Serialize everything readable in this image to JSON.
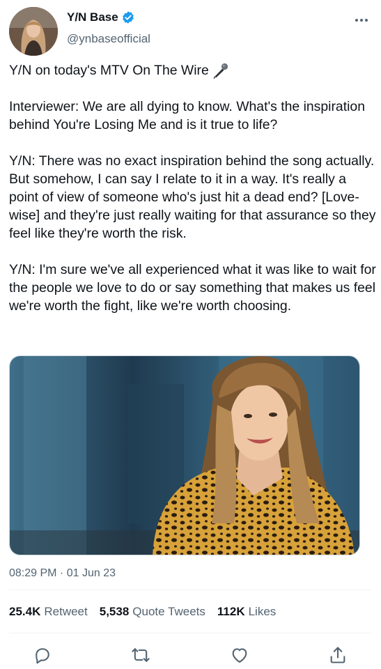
{
  "tweet": {
    "author": {
      "display_name": "Y/N Base",
      "handle": "@ynbaseofficial",
      "verified": true
    },
    "paragraphs": [
      "Y/N on today's MTV On The Wire",
      "Interviewer: We are all dying to know. What's the inspiration behind You're Losing Me and is it true to life?",
      "Y/N: There was no exact inspiration behind the song actually. But somehow, I can say I relate to it in a way. It's really a point of view of someone who's just hit a dead end? [Love-wise] and they're just really waiting for that assurance so they feel like they're worth the risk.",
      "Y/N: I'm sure we've all experienced what it was like to wait for the people we love to do or say something that makes us feel we're worth the fight, like we're worth choosing."
    ],
    "title_emoji": "microphone-icon",
    "timestamp": "08:29 PM · 01 Jun 23",
    "stats": {
      "retweets_count": "25.4K",
      "retweets_label": "Retweet",
      "quotes_count": "5,538",
      "quotes_label": "Quote Tweets",
      "likes_count": "112K",
      "likes_label": "Likes"
    },
    "actions": [
      "reply-icon",
      "retweet-icon",
      "like-icon",
      "share-icon"
    ]
  },
  "colors": {
    "text_primary": "#0f1419",
    "text_secondary": "#536471",
    "verified_blue": "#1d9bf0",
    "divider": "#eff3f4"
  }
}
